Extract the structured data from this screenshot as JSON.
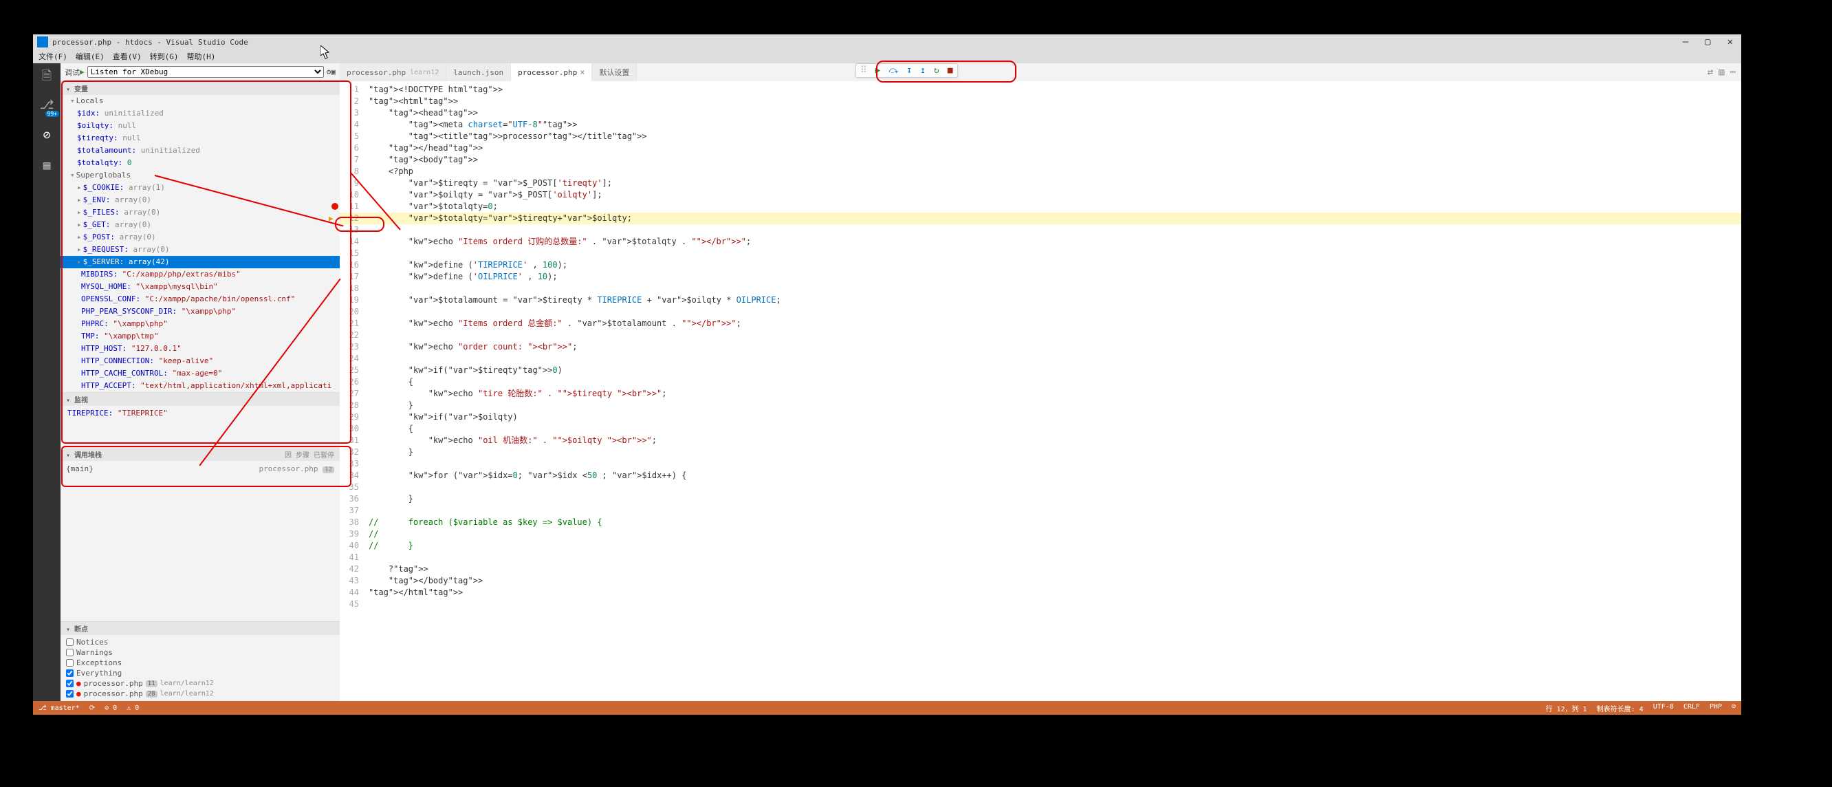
{
  "window": {
    "title": "processor.php - htdocs - Visual Studio Code"
  },
  "menubar": [
    "文件(F)",
    "编辑(E)",
    "查看(V)",
    "转到(G)",
    "帮助(H)"
  ],
  "titlectrls": {
    "min": "—",
    "max": "▢",
    "close": "✕"
  },
  "sidebar": {
    "debug_label": "调试",
    "config": "Listen for XDebug",
    "sections": {
      "vars": "变量",
      "watch": "监视",
      "callstack": "调用堆栈",
      "breakpoints": "断点"
    },
    "locals_hdr": "Locals",
    "super_hdr": "Superglobals",
    "locals": [
      {
        "k": "$idx:",
        "v": "uninitialized",
        "cls": "valk"
      },
      {
        "k": "$oilqty:",
        "v": "null",
        "cls": "valk"
      },
      {
        "k": "$tireqty:",
        "v": "null",
        "cls": "valk"
      },
      {
        "k": "$totalamount:",
        "v": "uninitialized",
        "cls": "valk"
      },
      {
        "k": "$totalqty:",
        "v": "0",
        "cls": "valn"
      }
    ],
    "supers": [
      {
        "k": "$_COOKIE:",
        "v": "array(1)"
      },
      {
        "k": "$_ENV:",
        "v": "array(0)"
      },
      {
        "k": "$_FILES:",
        "v": "array(0)"
      },
      {
        "k": "$_GET:",
        "v": "array(0)"
      },
      {
        "k": "$_POST:",
        "v": "array(0)"
      },
      {
        "k": "$_REQUEST:",
        "v": "array(0)"
      },
      {
        "k": "$_SERVER:",
        "v": "array(42)",
        "sel": true
      }
    ],
    "server": [
      {
        "k": "MIBDIRS:",
        "v": "\"C:/xampp/php/extras/mibs\""
      },
      {
        "k": "MYSQL_HOME:",
        "v": "\"\\xampp\\mysql\\bin\""
      },
      {
        "k": "OPENSSL_CONF:",
        "v": "\"C:/xampp/apache/bin/openssl.cnf\""
      },
      {
        "k": "PHP_PEAR_SYSCONF_DIR:",
        "v": "\"\\xampp\\php\""
      },
      {
        "k": "PHPRC:",
        "v": "\"\\xampp\\php\""
      },
      {
        "k": "TMP:",
        "v": "\"\\xampp\\tmp\""
      },
      {
        "k": "HTTP_HOST:",
        "v": "\"127.0.0.1\""
      },
      {
        "k": "HTTP_CONNECTION:",
        "v": "\"keep-alive\""
      },
      {
        "k": "HTTP_CACHE_CONTROL:",
        "v": "\"max-age=0\""
      },
      {
        "k": "HTTP_ACCEPT:",
        "v": "\"text/html,application/xhtml+xml,applicati"
      }
    ],
    "watch": {
      "k": "TIREPRICE:",
      "v": "\"TIREPRICE\""
    },
    "cs_right_label": "因 步骤 已暂停",
    "callstack": {
      "left": "{main}",
      "right": "processor.php",
      "ln": "12"
    },
    "breakpoints": {
      "opts": [
        {
          "l": "Notices",
          "c": false
        },
        {
          "l": "Warnings",
          "c": false
        },
        {
          "l": "Exceptions",
          "c": false
        },
        {
          "l": "Everything",
          "c": true
        }
      ],
      "files": [
        {
          "f": "processor.php",
          "ln": "11",
          "p": "learn/learn12",
          "c": true
        },
        {
          "f": "processor.php",
          "ln": "28",
          "p": "learn/learn12",
          "c": true
        }
      ]
    }
  },
  "tabs": [
    {
      "label": "processor.php",
      "dim": "learn12",
      "active": false
    },
    {
      "label": "launch.json",
      "active": false
    },
    {
      "label": "processor.php",
      "active": true,
      "close": true
    },
    {
      "label": "默认设置",
      "active": false
    }
  ],
  "debugbar": {
    "icons": [
      "⏵",
      "⤼",
      "↧",
      "↥",
      "↻",
      "■"
    ]
  },
  "statusbar": {
    "branch": "master*",
    "sync": "⟳",
    "err": "⊘ 0",
    "warn": "⚠ 0",
    "pos": "行 12，列 1",
    "tab": "制表符长度: 4",
    "enc": "UTF-8",
    "eol": "CRLF",
    "lang": "PHP",
    "smile": "☺"
  },
  "code": {
    "lines": [
      "<!DOCTYPE html>",
      "<html>",
      "    <head>",
      "        <meta charset=\"UTF-8\">",
      "        <title>processor</title>",
      "    </head>",
      "    <body>",
      "    <?php",
      "        $tireqty = $_POST['tireqty'];",
      "        $oilqty = $_POST['oilqty'];",
      "        $totalqty=0;",
      "        $totalqty=$tireqty+$oilqty;",
      "",
      "        echo \"Items orderd 订购的总数量:\" . $totalqty . \"</br>\";",
      "",
      "        define ('TIREPRICE' , 100);",
      "        define ('OILPRICE' , 10);",
      "",
      "        $totalamount = $tireqty * TIREPRICE + $oilqty * OILPRICE;",
      "",
      "        echo \"Items orderd 总金额:\" . $totalamount . \"</br>\";",
      "",
      "        echo \"order count: <br>\";",
      "",
      "        if($tireqty>0)",
      "        {",
      "            echo \"tire 轮胎数:\" . \"$tireqty <br>\";",
      "        }",
      "        if($oilqty)",
      "        {",
      "            echo \"oil 机油数:\" . \"$oilqty <br>\";",
      "        }",
      "",
      "        for ($idx=0; $idx <50 ; $idx++) { ",
      "",
      "        }",
      "",
      "//      foreach ($variable as $key => $value) {",
      "//          ",
      "//      }",
      "",
      "    ?>",
      "    </body>",
      "</html>",
      ""
    ],
    "current_line": 12,
    "bp_lines": [
      11
    ]
  }
}
